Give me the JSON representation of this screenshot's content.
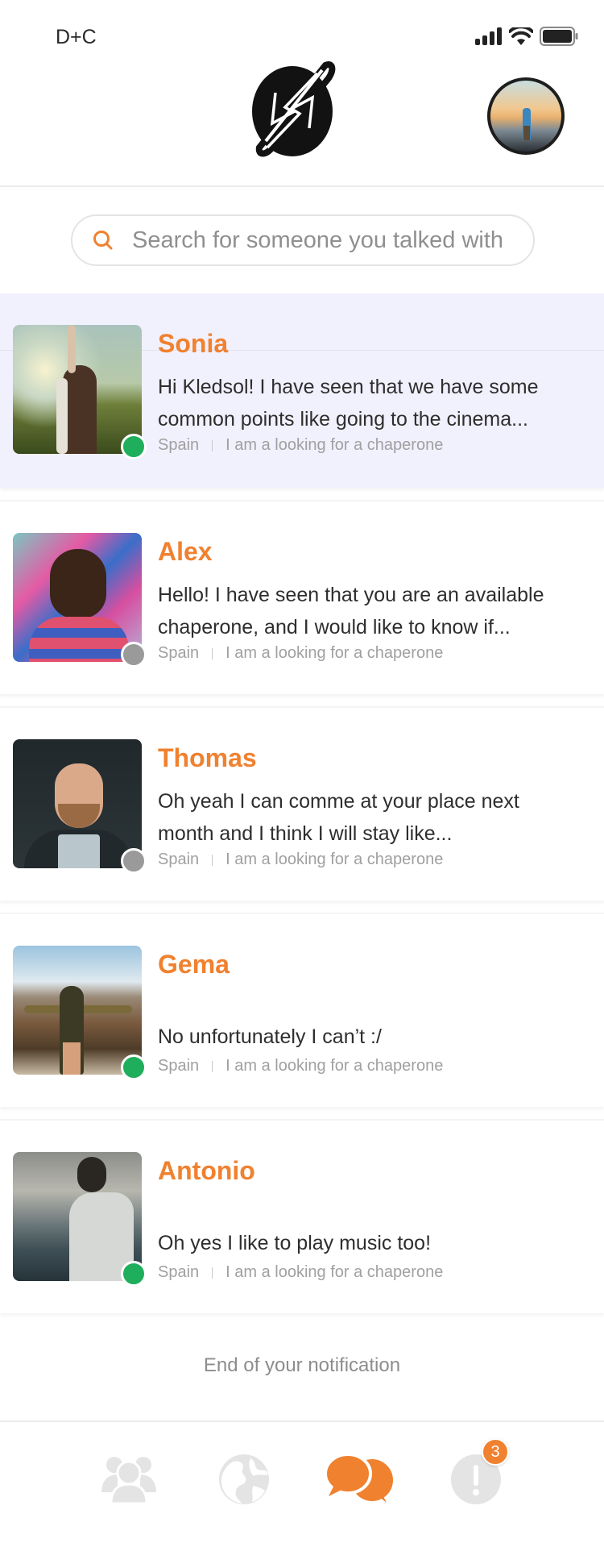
{
  "status_bar": {
    "carrier": "D+C"
  },
  "header": {
    "logo": "app-logo",
    "profile": "profile-avatar"
  },
  "search": {
    "placeholder": "Search for someone you talked with",
    "value": ""
  },
  "conversations": [
    {
      "name": "Sonia",
      "message": "Hi Kledsol! I have seen that we have some common points like going to the cinema...",
      "country": "Spain",
      "status": "I am a looking for a chaperone",
      "online": true,
      "active": true,
      "photo": "woman-in-sunflower-field"
    },
    {
      "name": "Alex",
      "message": "Hello! I have seen that you are an available chaperone, and I would like to know if...",
      "country": "Spain",
      "status": "I am a looking for a chaperone",
      "online": false,
      "active": false,
      "photo": "man-graffiti-wall"
    },
    {
      "name": "Thomas",
      "message": "Oh yeah I can comme at your place next month and I think I will stay like...",
      "country": "Spain",
      "status": "I am a looking for a chaperone",
      "online": false,
      "active": false,
      "photo": "bearded-man-dark-background"
    },
    {
      "name": "Gema",
      "message": "No unfortunately I can’t :/",
      "country": "Spain",
      "status": "I am a looking for a chaperone",
      "online": true,
      "active": false,
      "photo": "woman-canyon-view"
    },
    {
      "name": "Antonio",
      "message": "Oh yes I like to play music too!",
      "country": "Spain",
      "status": "I am a looking for a chaperone",
      "online": true,
      "active": false,
      "photo": "man-looking-at-sea"
    }
  ],
  "end_note": "End of your notification",
  "bottom_nav": {
    "items": [
      {
        "name": "community",
        "icon": "people-icon",
        "active": false
      },
      {
        "name": "explore",
        "icon": "globe-icon",
        "active": false
      },
      {
        "name": "messages",
        "icon": "chat-bubbles-icon",
        "active": true
      },
      {
        "name": "notifications",
        "icon": "alert-icon",
        "active": false,
        "badge": "3"
      }
    ]
  },
  "colors": {
    "accent": "#f0812f",
    "online": "#1fae5b",
    "offline": "#9a9a9a",
    "active_bg": "#f1f0fd",
    "inactive_icon": "#e4e4e4"
  }
}
